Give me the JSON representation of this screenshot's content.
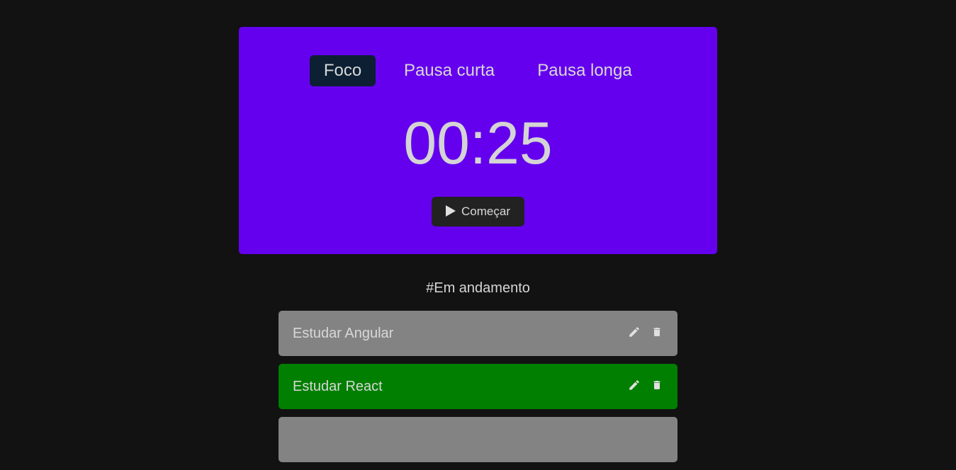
{
  "timer": {
    "tabs": [
      {
        "label": "Foco",
        "active": true
      },
      {
        "label": "Pausa curta",
        "active": false
      },
      {
        "label": "Pausa longa",
        "active": false
      }
    ],
    "time": "00:25",
    "start_label": "Começar",
    "start_icon": "play-icon",
    "card_color": "#6500ef",
    "active_tab_color": "#0c1f33"
  },
  "tasks_section": {
    "title": "#Em andamento",
    "items": [
      {
        "label": "Estudar Angular",
        "color": "#838383",
        "edit_icon": "pencil-icon",
        "delete_icon": "trash-icon"
      },
      {
        "label": "Estudar React",
        "color": "#007f00",
        "edit_icon": "pencil-icon",
        "delete_icon": "trash-icon"
      },
      {
        "label": "",
        "color": "#838383"
      }
    ]
  }
}
